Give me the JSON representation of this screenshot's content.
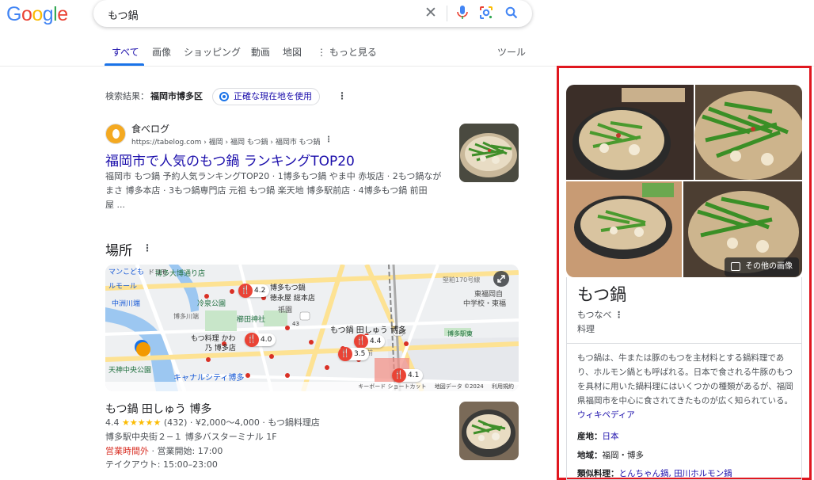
{
  "logo": "Google",
  "search": {
    "query": "もつ鍋"
  },
  "tabs": [
    "すべて",
    "画像",
    "ショッピング",
    "動画",
    "地図",
    "もっと見る"
  ],
  "tools_label": "ツール",
  "location": {
    "prefix": "検索結果：",
    "place": "福岡市博多区",
    "chip": "正確な現在地を使用"
  },
  "result": {
    "site": "食べログ",
    "url": "https://tabelog.com › 福岡 › 福岡 もつ鍋 › 福岡市 もつ鍋",
    "title": "福岡市で人気のもつ鍋 ランキングTOP20",
    "snippet_lines": [
      "福岡市 もつ鍋 予約人気ランキングTOP20 · 1博多もつ鍋 やま中 赤坂店 · 2もつ鍋なが",
      "まさ 博多本店 · 3もつ鍋専門店 元祖 もつ鍋 楽天地 博多駅前店 · 4博多もつ鍋 前田",
      "屋 ..."
    ]
  },
  "places": {
    "heading": "場所",
    "map": {
      "labels": [
        "博多大博通り店",
        "マンこども",
        "ドコモ",
        "ルモール",
        "中洲川端",
        "冷泉公園",
        "博多川端",
        "博多もつ鍋",
        "徳永屋 総本店",
        "祇園",
        "櫛田神社",
        "もつ鍋 田しゅう 博多",
        "もつ料理 かわ",
        "乃 博多店",
        "キャナルシティ博多",
        "天神中央公園",
        "博多駅東",
        "中学校・東福",
        "東福岡自",
        "堅粕170号線",
        "博多駅前",
        "キーボード ショートカット",
        "地図データ ©2024",
        "利用規約"
      ],
      "ratings": [
        "4.2",
        "4.0",
        "4.4",
        "3.5",
        "4.1"
      ],
      "road_numbers": [
        "43",
        "385"
      ]
    },
    "business": {
      "name": "もつ鍋 田しゅう 博多",
      "rating": "4.4",
      "stars": "★★★★★",
      "rating_tail": "(432) · ¥2,000～4,000 · もつ鍋料理店",
      "address": "博多駅中央街２−１ 博多バスターミナル 1F",
      "status": "営業時間外",
      "hours": " · 営業開始: 17:00",
      "takeout": "テイクアウト: 15:00–23:00"
    }
  },
  "knowledge_panel": {
    "more_images": "その他の画像",
    "title": "もつ鍋",
    "reading": "もつなべ",
    "type": "料理",
    "description": "もつ鍋は、牛または豚のもつを主材料とする鍋料理であり、ホルモン鍋とも呼ばれる。日本で食される牛豚のもつを具材に用いた鍋料理にはいくつかの種類があるが、福岡県福岡市を中心に食されてきたものが広く知られている。",
    "source": "ウィキペディア",
    "facts": [
      {
        "label": "産地：",
        "value": "日本"
      },
      {
        "label": "地域：",
        "value": "福岡・博多"
      },
      {
        "label": "類似料理：",
        "value": "とんちゃん鍋, 田川ホルモン鍋"
      }
    ]
  },
  "colors": {
    "accent": "#1a73e8",
    "link": "#1a0dab",
    "highlight_frame": "#e0171f"
  }
}
